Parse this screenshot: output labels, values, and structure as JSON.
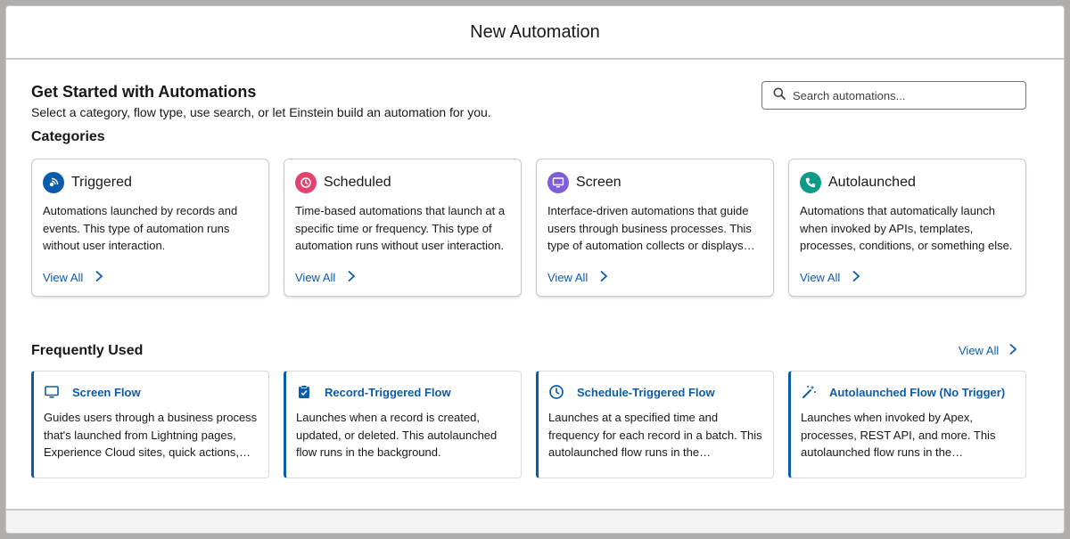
{
  "modal": {
    "title": "New Automation"
  },
  "intro": {
    "heading": "Get Started with Automations",
    "subtitle": "Select a category, flow type, use search, or let Einstein build an automation for you."
  },
  "search": {
    "placeholder": "Search automations..."
  },
  "categories": {
    "heading": "Categories",
    "items": [
      {
        "title": "Triggered",
        "icon": "triggered-icon",
        "color": "#0b5cab",
        "description": "Automations launched by records and events. This type of automation runs without user interaction.",
        "link": "View All"
      },
      {
        "title": "Scheduled",
        "icon": "clock-icon",
        "color": "#e3436f",
        "description": "Time-based automations that launch at a specific time or frequency. This type of automation runs without user interaction.",
        "link": "View All"
      },
      {
        "title": "Screen",
        "icon": "monitor-icon",
        "color": "#7f5ed8",
        "description": "Interface-driven automations that guide users through business processes. This type of automation collects or displays information.",
        "link": "View All"
      },
      {
        "title": "Autolaunched",
        "icon": "phone-icon",
        "color": "#0c9b8a",
        "description": "Automations that automatically launch when invoked by APIs, templates, processes, conditions, or something else.",
        "link": "View All"
      }
    ]
  },
  "frequently_used": {
    "heading": "Frequently Used",
    "view_all": "View All",
    "items": [
      {
        "title": "Screen Flow",
        "icon": "monitor-icon",
        "description": "Guides users through a business process that's launched from Lightning pages, Experience Cloud sites, quick actions, and more."
      },
      {
        "title": "Record-Triggered Flow",
        "icon": "clipboard-icon",
        "description": "Launches when a record is created, updated, or deleted. This autolaunched flow runs in the background."
      },
      {
        "title": "Schedule-Triggered Flow",
        "icon": "clock-icon",
        "description": "Launches at a specified time and frequency for each record in a batch. This autolaunched flow runs in the background."
      },
      {
        "title": "Autolaunched Flow (No Trigger)",
        "icon": "magic-wand-icon",
        "description": "Launches when invoked by Apex, processes, REST API, and more. This autolaunched flow runs in the background."
      }
    ]
  },
  "colors": {
    "link": "#0b5cab",
    "border": "#c9c9c9",
    "backdrop": "#b0adab"
  }
}
